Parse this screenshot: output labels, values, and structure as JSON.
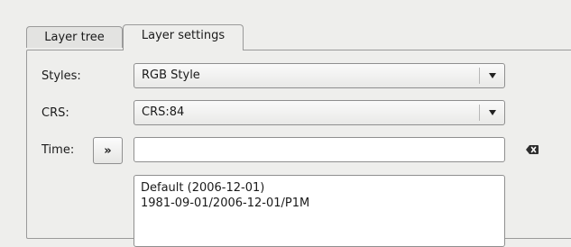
{
  "tabs": [
    {
      "label": "Layer tree"
    },
    {
      "label": "Layer settings"
    }
  ],
  "form": {
    "styles_label": "Styles:",
    "styles_value": "RGB Style",
    "crs_label": "CRS:",
    "crs_value": "CRS:84",
    "time_label": "Time:",
    "time_step_label": "»",
    "time_value": "",
    "time_values": [
      "Default (2006-12-01)",
      "1981-09-01/2006-12-01/P1M"
    ]
  }
}
